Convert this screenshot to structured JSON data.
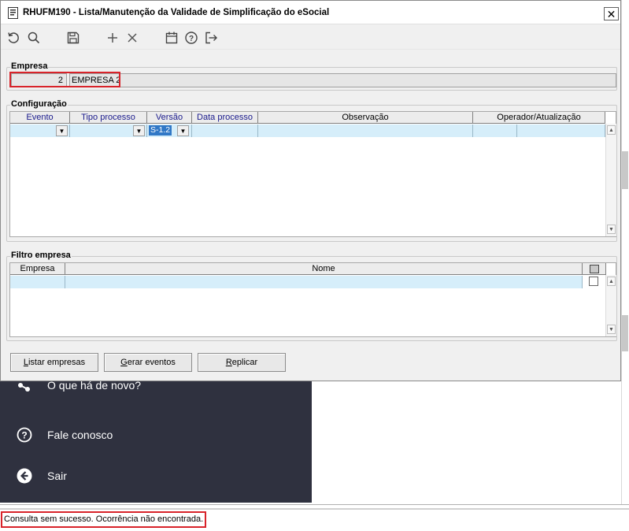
{
  "window": {
    "title": "RHUFM190 - Lista/Manutenção da Validade de Simplificação do eSocial",
    "close_label": "✕"
  },
  "toolbar": {
    "icons": [
      "undo-icon",
      "search-icon",
      "save-icon",
      "add-icon",
      "delete-icon",
      "calendar-icon",
      "help-icon",
      "exit-icon"
    ]
  },
  "empresa": {
    "label": "Empresa",
    "code": "2",
    "name": "EMPRESA 2"
  },
  "configuracao": {
    "label": "Configuração",
    "columns": [
      "Evento",
      "Tipo processo",
      "Versão",
      "Data processo",
      "Observação",
      "Operador/Atualização"
    ],
    "row": {
      "evento": "",
      "tipo_processo": "",
      "versao": "S-1.2",
      "data_processo": "",
      "observacao": "",
      "operador": ""
    }
  },
  "filtro": {
    "label": "Filtro empresa",
    "columns": [
      "Empresa",
      "Nome"
    ]
  },
  "buttons": {
    "listar_prefix": "L",
    "listar_rest": "istar empresas",
    "gerar_prefix": "G",
    "gerar_rest": "erar eventos",
    "replicar_prefix": "R",
    "replicar_rest": "eplicar"
  },
  "background_menu": {
    "items": [
      "O que há de novo?",
      "Fale conosco",
      "Sair"
    ]
  },
  "status": {
    "message": "Consulta sem sucesso. Ocorrência não encontrada."
  },
  "colors": {
    "highlight_border": "#d8232a",
    "row_highlight": "#d6eefa",
    "dark_panel": "#2f313f"
  }
}
